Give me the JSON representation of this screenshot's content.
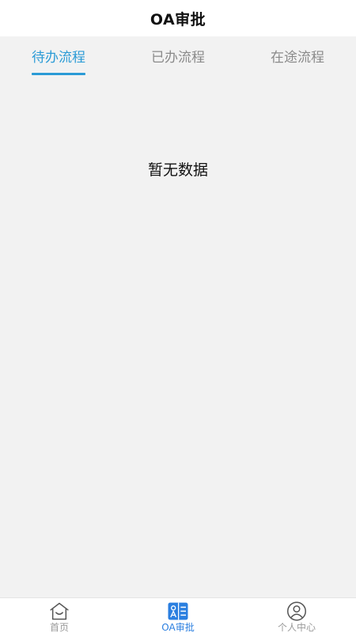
{
  "header": {
    "title": "OA审批"
  },
  "tabs": [
    {
      "label": "待办流程",
      "active": true
    },
    {
      "label": "已办流程",
      "active": false
    },
    {
      "label": "在途流程",
      "active": false
    }
  ],
  "content": {
    "empty_text": "暂无数据"
  },
  "bottom_nav": {
    "items": [
      {
        "label": "首页",
        "icon": "home-icon"
      },
      {
        "label": "OA审批",
        "icon": "oa-approval-icon",
        "active": true
      },
      {
        "label": "个人中心",
        "icon": "user-icon"
      }
    ]
  },
  "colors": {
    "accent": "#2b9bd6",
    "nav_active": "#2b7fe0",
    "inactive_text": "#8a8a8a",
    "background": "#f2f2f2"
  }
}
